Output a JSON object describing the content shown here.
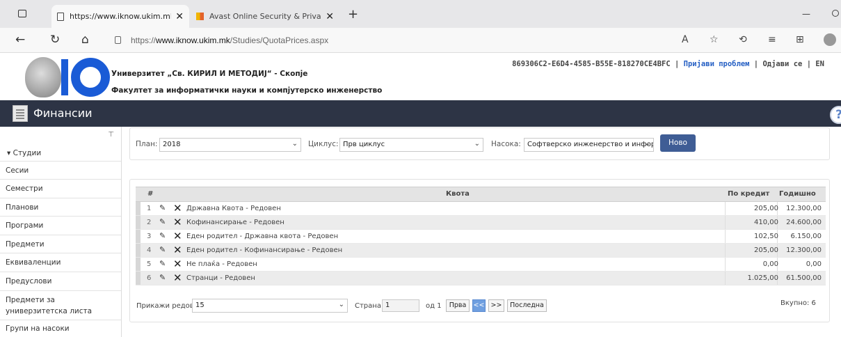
{
  "browser": {
    "tabs": [
      {
        "title": "https://www.iknow.ukim.mk/Stu",
        "close": "✕"
      },
      {
        "title": "Avast Online Security & Privacy",
        "close": "✕"
      }
    ],
    "new_tab": "+",
    "minimize": "—",
    "url_prefix": "https://",
    "url_host": "www.iknow.ukim.mk",
    "url_path": "/Studies/QuotaPrices.aspx"
  },
  "header": {
    "university": "Универзитет „Св. КИРИЛ И МЕТОДИЈ“ - Скопје",
    "faculty": "Факултет за информатички науки и компјутерско инженерство",
    "session_id": "869306C2-E6D4-4585-B55E-818270CE4BFC",
    "sep": "|",
    "report_problem": "Пријави проблем",
    "logout": "Одјави се",
    "lang": "EN"
  },
  "module": {
    "title": "Финансии",
    "help": "?"
  },
  "sidebar": {
    "pin": "✎",
    "section": "▾ Студии",
    "items": [
      {
        "label": "Сесии"
      },
      {
        "label": "Семестри"
      },
      {
        "label": "Планови"
      },
      {
        "label": "Програми"
      },
      {
        "label": "Предмети"
      },
      {
        "label": "Еквиваленции"
      },
      {
        "label": "Предуслови"
      },
      {
        "label": "Предмети за",
        "label2": "универзитетска листа"
      },
      {
        "label": "Групи на насоки"
      }
    ]
  },
  "filters": {
    "plan_label": "План:",
    "plan_value": "2018",
    "cycle_label": "Циклус:",
    "cycle_value": "Прв циклус",
    "track_label": "Насока:",
    "track_value": "Софтверско инженерство и инфор",
    "new_button": "Ново"
  },
  "grid": {
    "columns": {
      "num": "#",
      "quota": "Квота",
      "per_credit": "По кредит",
      "yearly": "Годишно"
    },
    "rows": [
      {
        "num": "1",
        "name": "Државна Квота - Редовен",
        "per_credit": "205,00",
        "yearly": "12.300,00"
      },
      {
        "num": "2",
        "name": "Кофинансирање - Редовен",
        "per_credit": "410,00",
        "yearly": "24.600,00"
      },
      {
        "num": "3",
        "name": "Еден родител - Државна квота - Редовен",
        "per_credit": "102,50",
        "yearly": "6.150,00"
      },
      {
        "num": "4",
        "name": "Еден родител - Кофинансирање - Редовен",
        "per_credit": "205,00",
        "yearly": "12.300,00"
      },
      {
        "num": "5",
        "name": "Не плаќа - Редовен",
        "per_credit": "0,00",
        "yearly": "0,00"
      },
      {
        "num": "6",
        "name": "Странци - Редовен",
        "per_credit": "1.025,00",
        "yearly": "61.500,00"
      }
    ],
    "pager": {
      "show_rows_label": "Прикажи редови:",
      "rows_value": "15",
      "page_label": "Страна",
      "page_value": "1",
      "of_label": "од 1",
      "first": "Прва",
      "prev": "<<",
      "next": ">>",
      "last": "Последна",
      "total": "Вкупно: 6"
    }
  },
  "colors": {
    "accent": "#3f5d95",
    "module_bar": "#2d3445",
    "logo_blue": "#1a5bd6"
  }
}
